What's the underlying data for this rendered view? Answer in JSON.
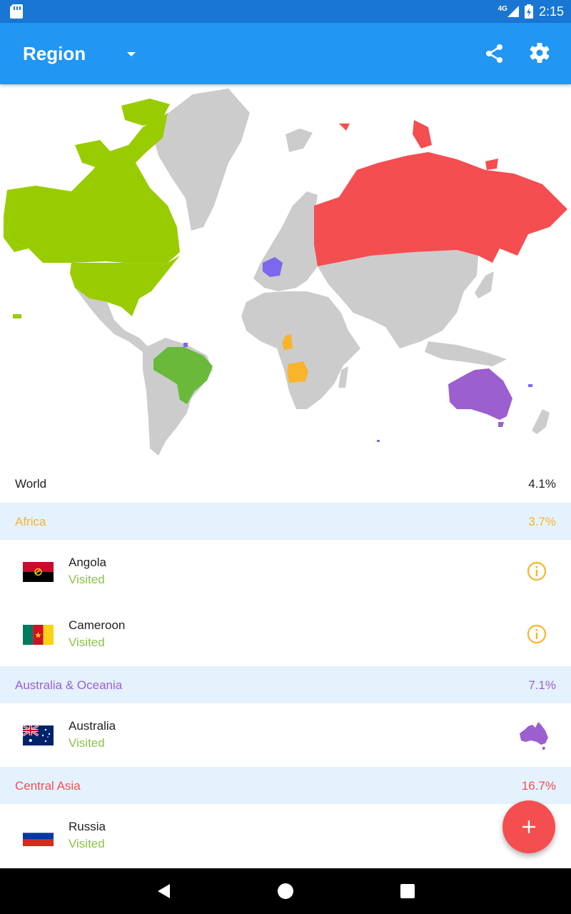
{
  "status_bar": {
    "network": "4G",
    "time": "2:15"
  },
  "app_bar": {
    "title": "Region"
  },
  "colors": {
    "primary": "#2196f3",
    "status_bar": "#1976d2",
    "visited": "#8bc34a",
    "africa": "#f8b42a",
    "oceania": "#9c5fd0",
    "central_asia": "#f44e51",
    "north_america": "#99cc00",
    "south_america": "#6ab93b",
    "europe": "#7b68ee",
    "unvisited": "#cccccc",
    "section_bg": "#e3f2fd"
  },
  "world": {
    "label": "World",
    "percent": "4.1%"
  },
  "sections": [
    {
      "name": "Africa",
      "percent": "3.7%",
      "items": [
        {
          "name": "Angola",
          "status": "Visited",
          "icon": "info-icon"
        },
        {
          "name": "Cameroon",
          "status": "Visited",
          "icon": "info-icon"
        }
      ]
    },
    {
      "name": "Australia & Oceania",
      "percent": "7.1%",
      "items": [
        {
          "name": "Australia",
          "status": "Visited",
          "icon": "australia-map-icon"
        }
      ]
    },
    {
      "name": "Central Asia",
      "percent": "16.7%",
      "items": [
        {
          "name": "Russia",
          "status": "Visited"
        }
      ]
    }
  ],
  "fab": {
    "icon": "plus-icon"
  }
}
